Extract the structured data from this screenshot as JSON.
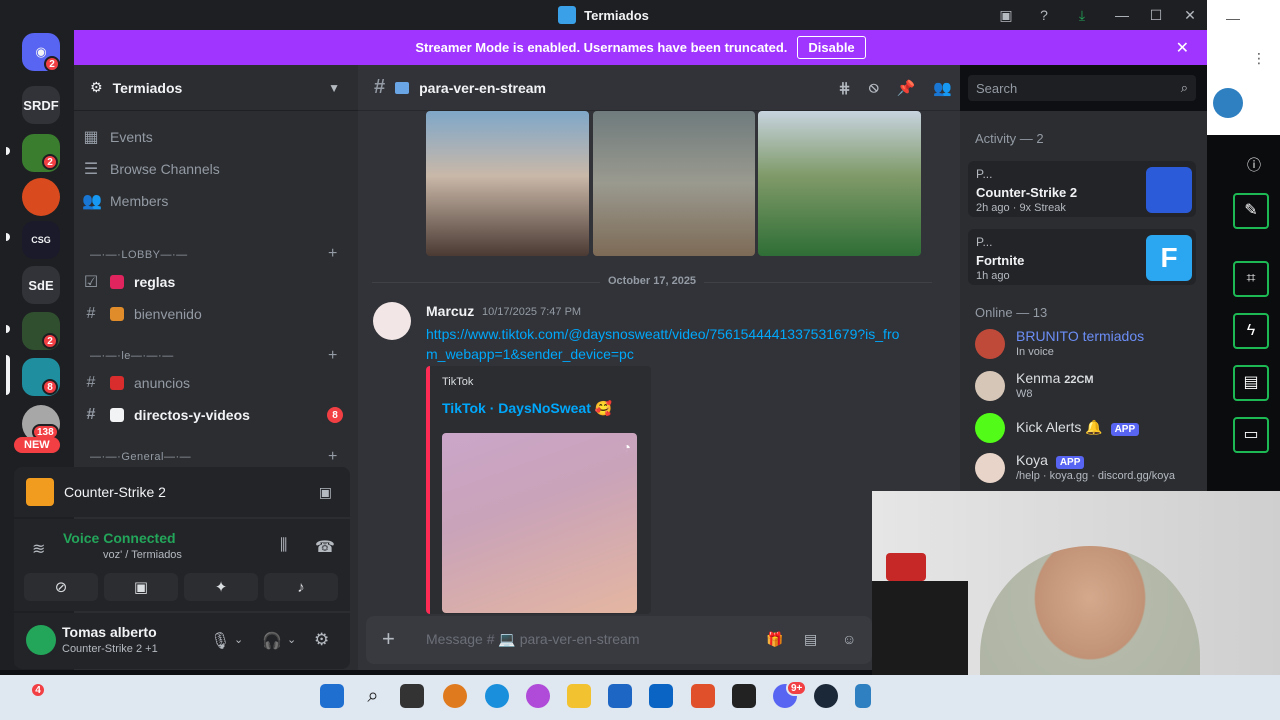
{
  "window": {
    "title": "Termiados",
    "min": "—",
    "max": "☐",
    "close": "✕"
  },
  "banner": {
    "text": "Streamer Mode is enabled. Usernames have been truncated.",
    "button": "Disable"
  },
  "rail": {
    "home_badge": "2",
    "servers": [
      {
        "label": "SRDF"
      },
      {
        "label": "SdE"
      }
    ],
    "badges": [
      "2",
      "2",
      "8",
      "138"
    ],
    "new_label": "NEW"
  },
  "guild": {
    "name": "Termiados"
  },
  "nav": {
    "events": "Events",
    "browse": "Browse Channels",
    "members": "Members"
  },
  "categories": {
    "lobby": "—·—·LOBBY—·—",
    "second": "—·—·le—·—·—",
    "general": "—·—·General—·—"
  },
  "channels": [
    {
      "name": "reglas"
    },
    {
      "name": "bienvenido"
    },
    {
      "name": "anuncios"
    },
    {
      "name": "directos-y-videos",
      "badge": "8"
    }
  ],
  "game_panel": {
    "title": "Counter-Strike 2"
  },
  "voice": {
    "status": "Voice Connected",
    "channel": "voz' / Termiados"
  },
  "user": {
    "name": "Tomas alberto",
    "status": "Counter-Strike 2 +1"
  },
  "chat": {
    "channel": "para-ver-en-stream",
    "search_placeholder": "Search",
    "date_divider": "October 17, 2025",
    "message": {
      "author": "Marcuz",
      "timestamp": "10/17/2025 7:47 PM",
      "link": "https://www.tiktok.com/@daysnosweatt/video/7561544441337531679?is_from_webapp=1&sender_device=pc",
      "embed_provider": "TikTok",
      "embed_title": "TikTok · DaysNoSweat 🥰"
    },
    "composer_placeholder": "Message # 💻 para-ver-en-stream"
  },
  "activity": {
    "title": "Activity — 2",
    "cards": [
      {
        "user": "P...",
        "game": "Counter-Strike 2",
        "meta": "2h ago",
        "streak": "9x Streak",
        "color": "#2b5bd9"
      },
      {
        "user": "P...",
        "game": "Fortnite",
        "meta": "1h ago",
        "color": "#2aa7f0"
      }
    ]
  },
  "online": {
    "title": "Online — 13",
    "members": [
      {
        "name": "BRUNITO termiados",
        "sub": "In voice",
        "color": "#6c8ef6"
      },
      {
        "name": "Kenma",
        "tag": "22CM",
        "sub": "W8",
        "color": "#dbdee1"
      },
      {
        "name": "Kick Alerts",
        "tag": "APP",
        "color": "#dbdee1"
      },
      {
        "name": "Koya",
        "tag": "APP",
        "sub": "/help · koya.gg · discord.gg/koya",
        "color": "#dbdee1"
      }
    ]
  },
  "taskbar": {
    "notif_badge": "4",
    "steam_badge": "9+"
  }
}
